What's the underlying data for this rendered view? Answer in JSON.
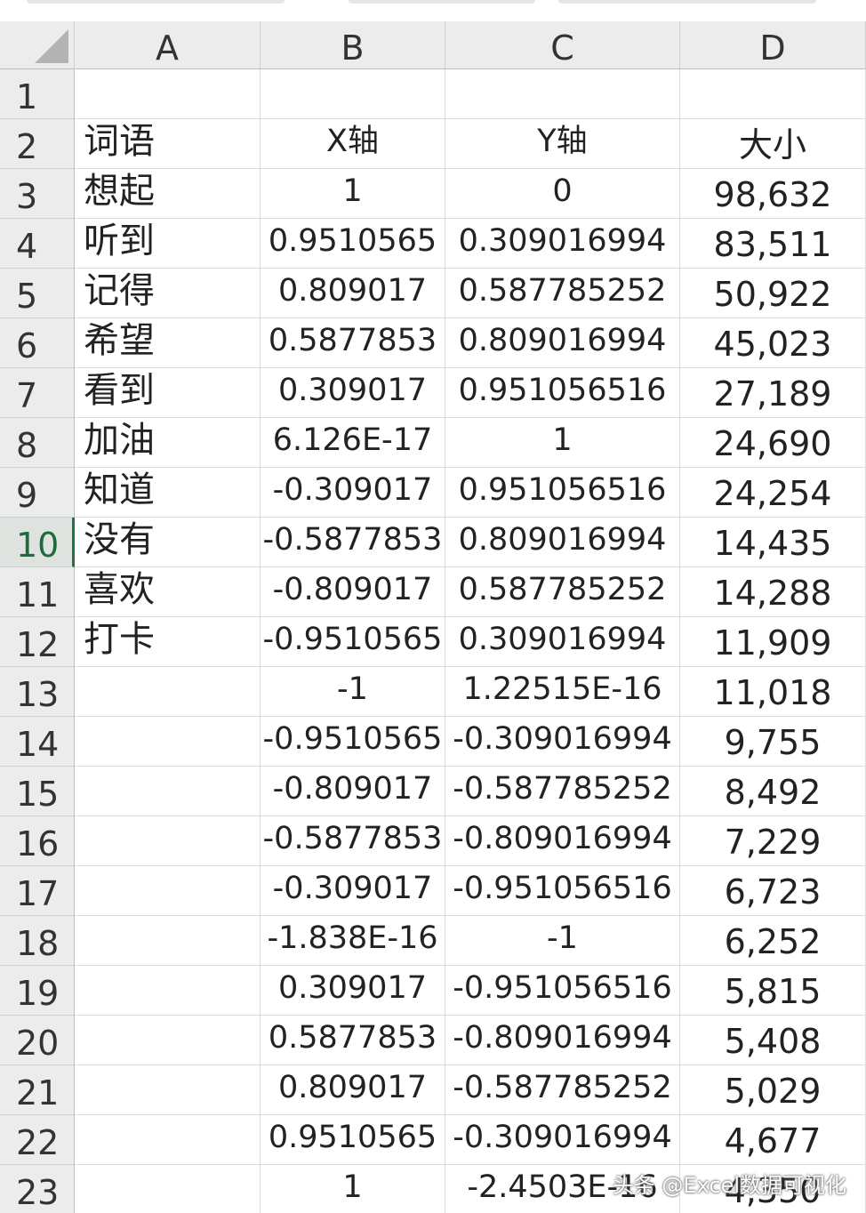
{
  "columns": [
    "A",
    "B",
    "C",
    "D"
  ],
  "rows": [
    {
      "n": "1",
      "a": "",
      "b": "",
      "c": "",
      "d": ""
    },
    {
      "n": "2",
      "a": "词语",
      "b": "X轴",
      "c": "Y轴",
      "d": "大小"
    },
    {
      "n": "3",
      "a": "想起",
      "b": "1",
      "c": "0",
      "d": "98,632"
    },
    {
      "n": "4",
      "a": "听到",
      "b": "0.9510565",
      "c": "0.309016994",
      "d": "83,511"
    },
    {
      "n": "5",
      "a": "记得",
      "b": "0.809017",
      "c": "0.587785252",
      "d": "50,922"
    },
    {
      "n": "6",
      "a": "希望",
      "b": "0.5877853",
      "c": "0.809016994",
      "d": "45,023"
    },
    {
      "n": "7",
      "a": "看到",
      "b": "0.309017",
      "c": "0.951056516",
      "d": "27,189"
    },
    {
      "n": "8",
      "a": "加油",
      "b": "6.126E-17",
      "c": "1",
      "d": "24,690"
    },
    {
      "n": "9",
      "a": "知道",
      "b": "-0.309017",
      "c": "0.951056516",
      "d": "24,254"
    },
    {
      "n": "10",
      "a": "没有",
      "b": "-0.5877853",
      "c": "0.809016994",
      "d": "14,435"
    },
    {
      "n": "11",
      "a": "喜欢",
      "b": "-0.809017",
      "c": "0.587785252",
      "d": "14,288"
    },
    {
      "n": "12",
      "a": "打卡",
      "b": "-0.9510565",
      "c": "0.309016994",
      "d": "11,909"
    },
    {
      "n": "13",
      "a": "",
      "b": "-1",
      "c": "1.22515E-16",
      "d": "11,018"
    },
    {
      "n": "14",
      "a": "",
      "b": "-0.9510565",
      "c": "-0.309016994",
      "d": "9,755"
    },
    {
      "n": "15",
      "a": "",
      "b": "-0.809017",
      "c": "-0.587785252",
      "d": "8,492"
    },
    {
      "n": "16",
      "a": "",
      "b": "-0.5877853",
      "c": "-0.809016994",
      "d": "7,229"
    },
    {
      "n": "17",
      "a": "",
      "b": "-0.309017",
      "c": "-0.951056516",
      "d": "6,723"
    },
    {
      "n": "18",
      "a": "",
      "b": "-1.838E-16",
      "c": "-1",
      "d": "6,252"
    },
    {
      "n": "19",
      "a": "",
      "b": "0.309017",
      "c": "-0.951056516",
      "d": "5,815"
    },
    {
      "n": "20",
      "a": "",
      "b": "0.5877853",
      "c": "-0.809016994",
      "d": "5,408"
    },
    {
      "n": "21",
      "a": "",
      "b": "0.809017",
      "c": "-0.587785252",
      "d": "5,029"
    },
    {
      "n": "22",
      "a": "",
      "b": "0.9510565",
      "c": "-0.309016994",
      "d": "4,677"
    },
    {
      "n": "23",
      "a": "",
      "b": "1",
      "c": "-2.4503E-16",
      "d": "4,350"
    }
  ],
  "active_row": "10",
  "watermark": "头条 @Excel数据可视化",
  "colors": {
    "header_bg": "#ececec",
    "active_row_accent": "#1f7244",
    "grid": "#dadada"
  }
}
